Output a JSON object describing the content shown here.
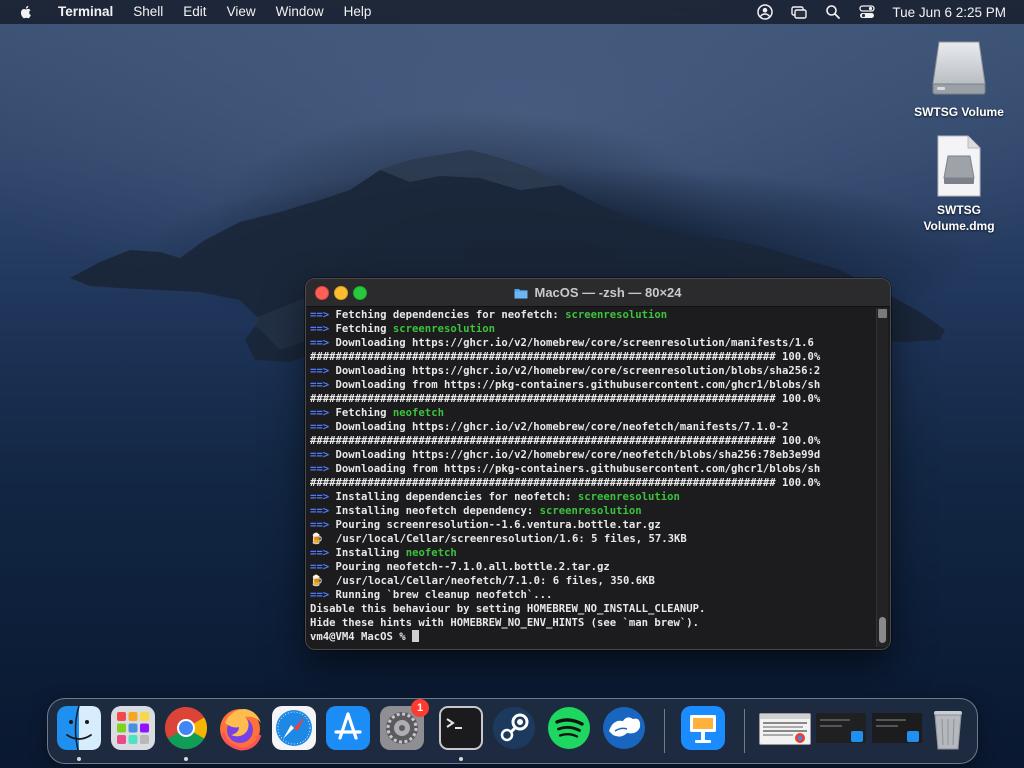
{
  "menubar": {
    "app_name": "Terminal",
    "items": [
      "Shell",
      "Edit",
      "View",
      "Window",
      "Help"
    ],
    "clock": "Tue Jun 6  2:25 PM"
  },
  "desktop_icons": [
    {
      "label": "SWTSG Volume",
      "icon": "external-drive-icon"
    },
    {
      "label": "SWTSG Volume.dmg",
      "icon": "disk-image-icon"
    }
  ],
  "terminal": {
    "title": "MacOS — -zsh — 80×24",
    "lines": [
      {
        "prefix": "==>",
        "text": " Fetching dependencies for neofetch: ",
        "highlight": "screenresolution"
      },
      {
        "prefix": "==>",
        "text": " Fetching ",
        "highlight": "screenresolution"
      },
      {
        "prefix": "==>",
        "text": " Downloading https://ghcr.io/v2/homebrew/core/screenresolution/manifests/1.6",
        "highlight": ""
      },
      {
        "prefix": "",
        "text": "######################################################################### 100.0%",
        "highlight": ""
      },
      {
        "prefix": "==>",
        "text": " Downloading https://ghcr.io/v2/homebrew/core/screenresolution/blobs/sha256:2",
        "highlight": ""
      },
      {
        "prefix": "==>",
        "text": " Downloading from https://pkg-containers.githubusercontent.com/ghcr1/blobs/sh",
        "highlight": ""
      },
      {
        "prefix": "",
        "text": "######################################################################### 100.0%",
        "highlight": ""
      },
      {
        "prefix": "==>",
        "text": " Fetching ",
        "highlight": "neofetch"
      },
      {
        "prefix": "==>",
        "text": " Downloading https://ghcr.io/v2/homebrew/core/neofetch/manifests/7.1.0-2",
        "highlight": ""
      },
      {
        "prefix": "",
        "text": "######################################################################### 100.0%",
        "highlight": ""
      },
      {
        "prefix": "==>",
        "text": " Downloading https://ghcr.io/v2/homebrew/core/neofetch/blobs/sha256:78eb3e99d",
        "highlight": ""
      },
      {
        "prefix": "==>",
        "text": " Downloading from https://pkg-containers.githubusercontent.com/ghcr1/blobs/sh",
        "highlight": ""
      },
      {
        "prefix": "",
        "text": "######################################################################### 100.0%",
        "highlight": ""
      },
      {
        "prefix": "==>",
        "text": " Installing dependencies for neofetch: ",
        "highlight": "screenresolution"
      },
      {
        "prefix": "==>",
        "text": " Installing neofetch dependency: ",
        "highlight": "screenresolution"
      },
      {
        "prefix": "==>",
        "text": " Pouring screenresolution--1.6.ventura.bottle.tar.gz",
        "highlight": ""
      },
      {
        "prefix": "🍺",
        "text": "  /usr/local/Cellar/screenresolution/1.6: 5 files, 57.3KB",
        "highlight": ""
      },
      {
        "prefix": "==>",
        "text": " Installing ",
        "highlight": "neofetch"
      },
      {
        "prefix": "==>",
        "text": " Pouring neofetch--7.1.0.all.bottle.2.tar.gz",
        "highlight": ""
      },
      {
        "prefix": "🍺",
        "text": "  /usr/local/Cellar/neofetch/7.1.0: 6 files, 350.6KB",
        "highlight": ""
      },
      {
        "prefix": "==>",
        "text": " Running `brew cleanup neofetch`...",
        "highlight": ""
      },
      {
        "prefix": "",
        "text": "Disable this behaviour by setting HOMEBREW_NO_INSTALL_CLEANUP.",
        "highlight": ""
      },
      {
        "prefix": "",
        "text": "Hide these hints with HOMEBREW_NO_ENV_HINTS (see `man brew`).",
        "highlight": ""
      }
    ],
    "prompt": "vm4@VM4 MacOS % "
  },
  "dock": {
    "items": [
      {
        "name": "finder",
        "running": true
      },
      {
        "name": "launchpad",
        "running": false
      },
      {
        "name": "chrome",
        "running": true
      },
      {
        "name": "firefox",
        "running": false
      },
      {
        "name": "safari",
        "running": false
      },
      {
        "name": "app-store",
        "running": false
      },
      {
        "name": "system-preferences",
        "running": false,
        "badge": "1"
      },
      {
        "name": "terminal",
        "running": true
      },
      {
        "name": "steam",
        "running": false
      },
      {
        "name": "spotify",
        "running": false
      },
      {
        "name": "openoffice",
        "running": false
      },
      {
        "name": "keynote",
        "running": false
      }
    ],
    "badge_count": "1"
  },
  "colors": {
    "arrow_blue": "#4f7cff",
    "highlight_green": "#3cc23c",
    "terminal_bg": "#1c1c1e"
  }
}
